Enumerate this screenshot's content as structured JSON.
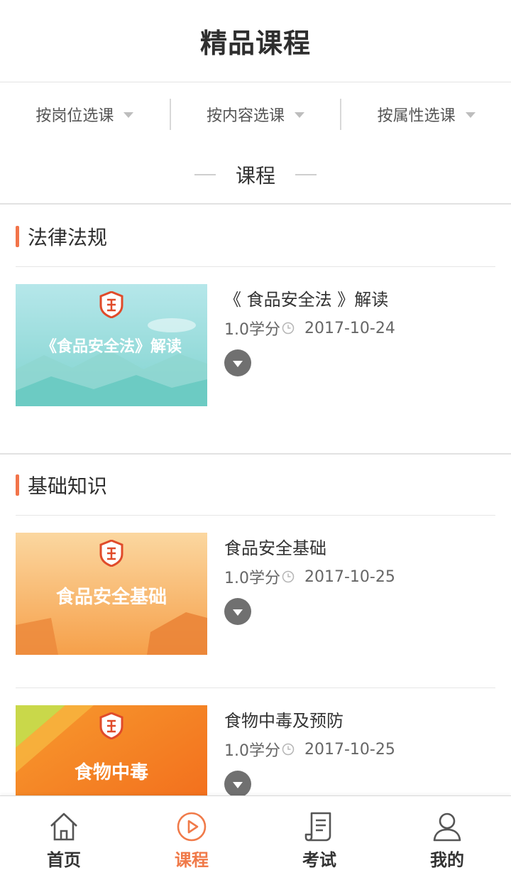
{
  "header": {
    "title": "精品课程"
  },
  "filters": [
    {
      "label": "按岗位选课"
    },
    {
      "label": "按内容选课"
    },
    {
      "label": "按属性选课"
    }
  ],
  "section_heading": "课程",
  "categories": [
    {
      "title": "法律法规",
      "courses": [
        {
          "title": "《 食品安全法 》解读",
          "credits": "1.0学分",
          "date": "2017-10-24",
          "thumb_text": "《食品安全法》解读"
        }
      ]
    },
    {
      "title": "基础知识",
      "courses": [
        {
          "title": "食品安全基础",
          "credits": "1.0学分",
          "date": "2017-10-25",
          "thumb_text": "食品安全基础"
        },
        {
          "title": "食物中毒及预防",
          "credits": "1.0学分",
          "date": "2017-10-25",
          "thumb_text": "食物中毒"
        }
      ]
    }
  ],
  "tabs": [
    {
      "label": "首页",
      "icon": "home-icon"
    },
    {
      "label": "课程",
      "icon": "play-circle-icon"
    },
    {
      "label": "考试",
      "icon": "scroll-icon"
    },
    {
      "label": "我的",
      "icon": "user-icon"
    }
  ],
  "colors": {
    "accent": "#f07a49",
    "category_bar": "#f2744a",
    "caret": "#bdbdbd"
  }
}
